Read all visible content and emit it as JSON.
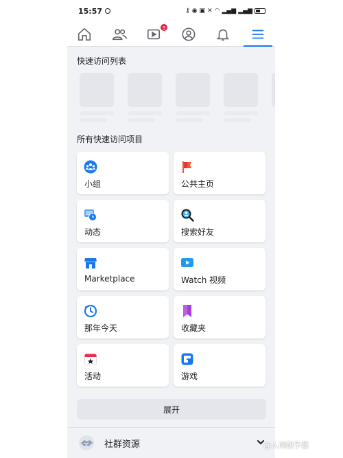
{
  "status_bar": {
    "time": "15:57"
  },
  "nav": {
    "video_badge": "9",
    "items": [
      "home-icon",
      "friends-icon",
      "video-icon",
      "profile-icon",
      "bell-icon",
      "menu-icon"
    ]
  },
  "shortcuts": {
    "title": "快速访问列表"
  },
  "all_shortcuts": {
    "title": "所有快速访问项目",
    "items": [
      {
        "label": "小组",
        "icon": "groups-icon"
      },
      {
        "label": "公共主页",
        "icon": "pages-flag-icon"
      },
      {
        "label": "动态",
        "icon": "feeds-clock-icon"
      },
      {
        "label": "搜索好友",
        "icon": "find-friends-icon"
      },
      {
        "label": "Marketplace",
        "icon": "marketplace-icon"
      },
      {
        "label": "Watch 视频",
        "icon": "watch-video-icon"
      },
      {
        "label": "那年今天",
        "icon": "memories-icon"
      },
      {
        "label": "收藏夹",
        "icon": "saved-bookmark-icon"
      },
      {
        "label": "活动",
        "icon": "events-calendar-icon"
      },
      {
        "label": "游戏",
        "icon": "gaming-icon"
      }
    ]
  },
  "expand_button": {
    "label": "展开"
  },
  "community": {
    "label": "社群资源"
  },
  "watermark": {
    "text": "@人间朝予暮"
  },
  "colors": {
    "accent": "#1877f2",
    "badge": "#e41e3f",
    "background": "#f0f2f5"
  }
}
